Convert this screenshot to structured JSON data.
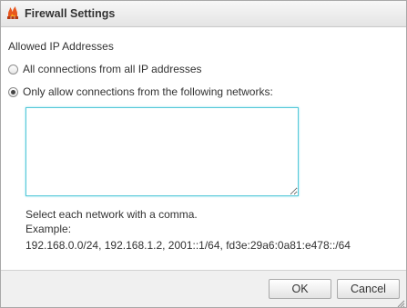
{
  "window": {
    "title": "Firewall Settings",
    "icon": "firewall-icon"
  },
  "section": {
    "label": "Allowed IP Addresses"
  },
  "options": [
    {
      "label": "All connections from all IP addresses",
      "selected": false
    },
    {
      "label": "Only allow connections from the following networks:",
      "selected": true
    }
  ],
  "networks_input": {
    "value": ""
  },
  "hint": {
    "line1": "Select each network with a comma.",
    "line2": "Example:",
    "line3": "192.168.0.0/24, 192.168.1.2, 2001::1/64, fd3e:29a6:0a81:e478::/64"
  },
  "buttons": {
    "ok": "OK",
    "cancel": "Cancel"
  },
  "colors": {
    "input_focus_border": "#55c8d8",
    "icon_flame": "#e8561d",
    "icon_wall": "#c9421a"
  }
}
